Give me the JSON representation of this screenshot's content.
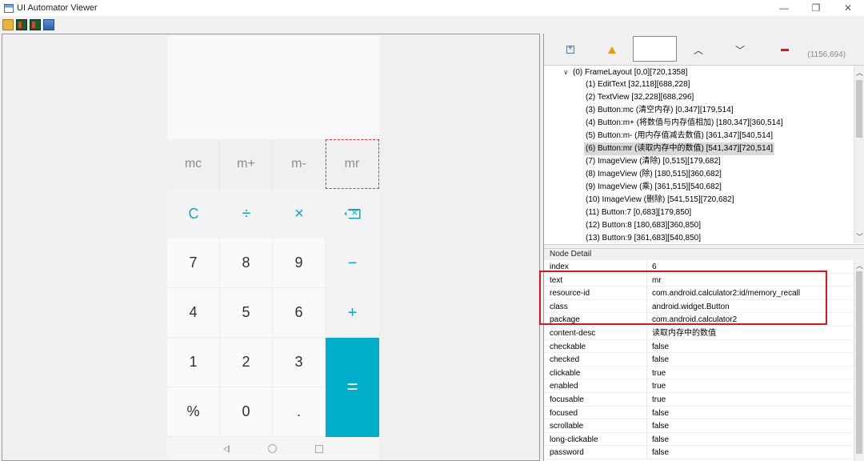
{
  "window": {
    "title": "UI Automator Viewer",
    "controls": [
      "—",
      "❐",
      "✕"
    ]
  },
  "toolbar": {
    "buttons": [
      "open-icon",
      "device-screenshot-icon",
      "device-screenshot-compressed-icon",
      "save-icon"
    ]
  },
  "phone": {
    "memory_keys": [
      "mc",
      "m+",
      "m-",
      "mr"
    ],
    "row2": [
      "C",
      "÷",
      "×"
    ],
    "rows": [
      [
        "7",
        "8",
        "9",
        "−"
      ],
      [
        "4",
        "5",
        "6",
        "+"
      ],
      [
        "1",
        "2",
        "3"
      ],
      [
        "%",
        "0",
        "."
      ]
    ],
    "equals": "=",
    "selected_key": "mr"
  },
  "tree_toolbar": {
    "coords": "(1156,694)"
  },
  "tree": {
    "items": [
      {
        "label": "(0) FrameLayout [0,0][720,1358]",
        "depth": 0,
        "expanded": true
      },
      {
        "label": "(1) EditText [32,118][688,228]",
        "depth": 1
      },
      {
        "label": "(2) TextView [32,228][688,296]",
        "depth": 1
      },
      {
        "label": "(3) Button:mc (清空内存) [0,347][179,514]",
        "depth": 1
      },
      {
        "label": "(4) Button:m+ (将数值与内存值相加) [180,347][360,514]",
        "depth": 1
      },
      {
        "label": "(5) Button:m- (用内存值减去数值) [361,347][540,514]",
        "depth": 1
      },
      {
        "label": "(6) Button:mr (读取内存中的数值) [541,347][720,514]",
        "depth": 1,
        "selected": true
      },
      {
        "label": "(7) ImageView (清除) [0,515][179,682]",
        "depth": 1
      },
      {
        "label": "(8) ImageView (除) [180,515][360,682]",
        "depth": 1
      },
      {
        "label": "(9) ImageView (乘) [361,515][540,682]",
        "depth": 1
      },
      {
        "label": "(10) ImageView (删除) [541,515][720,682]",
        "depth": 1
      },
      {
        "label": "(11) Button:7 [0,683][179,850]",
        "depth": 1
      },
      {
        "label": "(12) Button:8 [180,683][360,850]",
        "depth": 1
      },
      {
        "label": "(13) Button:9 [361,683][540,850]",
        "depth": 1
      }
    ]
  },
  "node_detail": {
    "title": "Node Detail",
    "rows": [
      {
        "key": "index",
        "value": "6"
      },
      {
        "key": "text",
        "value": "mr"
      },
      {
        "key": "resource-id",
        "value": "com.android.calculator2:id/memory_recall"
      },
      {
        "key": "class",
        "value": "android.widget.Button"
      },
      {
        "key": "package",
        "value": "com.android.calculator2"
      },
      {
        "key": "content-desc",
        "value": "读取内存中的数值"
      },
      {
        "key": "checkable",
        "value": "false"
      },
      {
        "key": "checked",
        "value": "false"
      },
      {
        "key": "clickable",
        "value": "true"
      },
      {
        "key": "enabled",
        "value": "true"
      },
      {
        "key": "focusable",
        "value": "true"
      },
      {
        "key": "focused",
        "value": "false"
      },
      {
        "key": "scrollable",
        "value": "false"
      },
      {
        "key": "long-clickable",
        "value": "false"
      },
      {
        "key": "password",
        "value": "false"
      }
    ]
  },
  "colors": {
    "accent": "#00aec9",
    "highlight": "#e2131e",
    "selection_outline": "#e03535"
  }
}
